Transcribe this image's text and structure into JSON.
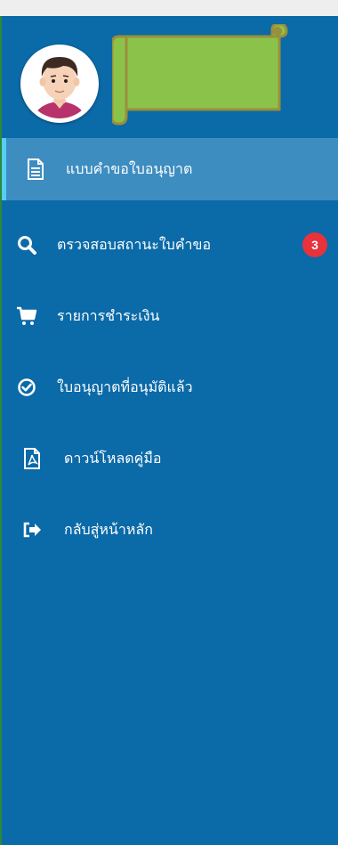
{
  "menu": {
    "items": [
      {
        "label": "แบบคำขอใบอนุญาต",
        "icon": "document-icon",
        "active": true
      },
      {
        "label": "ตรวจสอบสถานะใบคำขอ",
        "icon": "search-icon",
        "badge": "3"
      },
      {
        "label": "รายการชำระเงิน",
        "icon": "cart-icon"
      },
      {
        "label": "ใบอนุญาตที่อนุมัติแล้ว",
        "icon": "check-circle-icon"
      },
      {
        "label": "ดาวน์โหลดคู่มือ",
        "icon": "pdf-file-icon"
      },
      {
        "label": "กลับสู่หน้าหลัก",
        "icon": "sign-out-icon"
      }
    ]
  },
  "colors": {
    "sidebar_bg": "#0b6aa8",
    "active_bg": "#3d8dc0",
    "active_bar": "#58cdf3",
    "badge_bg": "#e8323c",
    "banner_fill": "#8bc34a"
  }
}
